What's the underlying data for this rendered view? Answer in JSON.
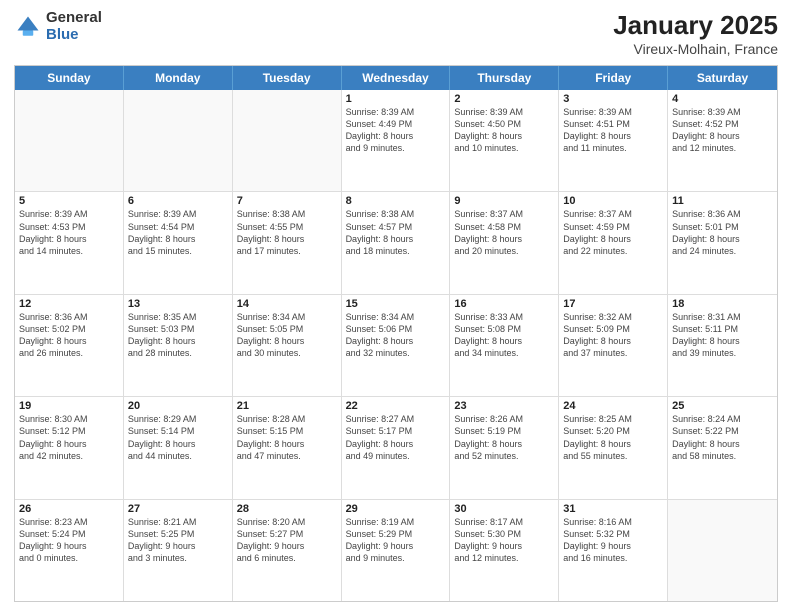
{
  "logo": {
    "general": "General",
    "blue": "Blue"
  },
  "title": "January 2025",
  "subtitle": "Vireux-Molhain, France",
  "days": [
    "Sunday",
    "Monday",
    "Tuesday",
    "Wednesday",
    "Thursday",
    "Friday",
    "Saturday"
  ],
  "weeks": [
    [
      {
        "day": "",
        "info": ""
      },
      {
        "day": "",
        "info": ""
      },
      {
        "day": "",
        "info": ""
      },
      {
        "day": "1",
        "info": "Sunrise: 8:39 AM\nSunset: 4:49 PM\nDaylight: 8 hours\nand 9 minutes."
      },
      {
        "day": "2",
        "info": "Sunrise: 8:39 AM\nSunset: 4:50 PM\nDaylight: 8 hours\nand 10 minutes."
      },
      {
        "day": "3",
        "info": "Sunrise: 8:39 AM\nSunset: 4:51 PM\nDaylight: 8 hours\nand 11 minutes."
      },
      {
        "day": "4",
        "info": "Sunrise: 8:39 AM\nSunset: 4:52 PM\nDaylight: 8 hours\nand 12 minutes."
      }
    ],
    [
      {
        "day": "5",
        "info": "Sunrise: 8:39 AM\nSunset: 4:53 PM\nDaylight: 8 hours\nand 14 minutes."
      },
      {
        "day": "6",
        "info": "Sunrise: 8:39 AM\nSunset: 4:54 PM\nDaylight: 8 hours\nand 15 minutes."
      },
      {
        "day": "7",
        "info": "Sunrise: 8:38 AM\nSunset: 4:55 PM\nDaylight: 8 hours\nand 17 minutes."
      },
      {
        "day": "8",
        "info": "Sunrise: 8:38 AM\nSunset: 4:57 PM\nDaylight: 8 hours\nand 18 minutes."
      },
      {
        "day": "9",
        "info": "Sunrise: 8:37 AM\nSunset: 4:58 PM\nDaylight: 8 hours\nand 20 minutes."
      },
      {
        "day": "10",
        "info": "Sunrise: 8:37 AM\nSunset: 4:59 PM\nDaylight: 8 hours\nand 22 minutes."
      },
      {
        "day": "11",
        "info": "Sunrise: 8:36 AM\nSunset: 5:01 PM\nDaylight: 8 hours\nand 24 minutes."
      }
    ],
    [
      {
        "day": "12",
        "info": "Sunrise: 8:36 AM\nSunset: 5:02 PM\nDaylight: 8 hours\nand 26 minutes."
      },
      {
        "day": "13",
        "info": "Sunrise: 8:35 AM\nSunset: 5:03 PM\nDaylight: 8 hours\nand 28 minutes."
      },
      {
        "day": "14",
        "info": "Sunrise: 8:34 AM\nSunset: 5:05 PM\nDaylight: 8 hours\nand 30 minutes."
      },
      {
        "day": "15",
        "info": "Sunrise: 8:34 AM\nSunset: 5:06 PM\nDaylight: 8 hours\nand 32 minutes."
      },
      {
        "day": "16",
        "info": "Sunrise: 8:33 AM\nSunset: 5:08 PM\nDaylight: 8 hours\nand 34 minutes."
      },
      {
        "day": "17",
        "info": "Sunrise: 8:32 AM\nSunset: 5:09 PM\nDaylight: 8 hours\nand 37 minutes."
      },
      {
        "day": "18",
        "info": "Sunrise: 8:31 AM\nSunset: 5:11 PM\nDaylight: 8 hours\nand 39 minutes."
      }
    ],
    [
      {
        "day": "19",
        "info": "Sunrise: 8:30 AM\nSunset: 5:12 PM\nDaylight: 8 hours\nand 42 minutes."
      },
      {
        "day": "20",
        "info": "Sunrise: 8:29 AM\nSunset: 5:14 PM\nDaylight: 8 hours\nand 44 minutes."
      },
      {
        "day": "21",
        "info": "Sunrise: 8:28 AM\nSunset: 5:15 PM\nDaylight: 8 hours\nand 47 minutes."
      },
      {
        "day": "22",
        "info": "Sunrise: 8:27 AM\nSunset: 5:17 PM\nDaylight: 8 hours\nand 49 minutes."
      },
      {
        "day": "23",
        "info": "Sunrise: 8:26 AM\nSunset: 5:19 PM\nDaylight: 8 hours\nand 52 minutes."
      },
      {
        "day": "24",
        "info": "Sunrise: 8:25 AM\nSunset: 5:20 PM\nDaylight: 8 hours\nand 55 minutes."
      },
      {
        "day": "25",
        "info": "Sunrise: 8:24 AM\nSunset: 5:22 PM\nDaylight: 8 hours\nand 58 minutes."
      }
    ],
    [
      {
        "day": "26",
        "info": "Sunrise: 8:23 AM\nSunset: 5:24 PM\nDaylight: 9 hours\nand 0 minutes."
      },
      {
        "day": "27",
        "info": "Sunrise: 8:21 AM\nSunset: 5:25 PM\nDaylight: 9 hours\nand 3 minutes."
      },
      {
        "day": "28",
        "info": "Sunrise: 8:20 AM\nSunset: 5:27 PM\nDaylight: 9 hours\nand 6 minutes."
      },
      {
        "day": "29",
        "info": "Sunrise: 8:19 AM\nSunset: 5:29 PM\nDaylight: 9 hours\nand 9 minutes."
      },
      {
        "day": "30",
        "info": "Sunrise: 8:17 AM\nSunset: 5:30 PM\nDaylight: 9 hours\nand 12 minutes."
      },
      {
        "day": "31",
        "info": "Sunrise: 8:16 AM\nSunset: 5:32 PM\nDaylight: 9 hours\nand 16 minutes."
      },
      {
        "day": "",
        "info": ""
      }
    ]
  ]
}
